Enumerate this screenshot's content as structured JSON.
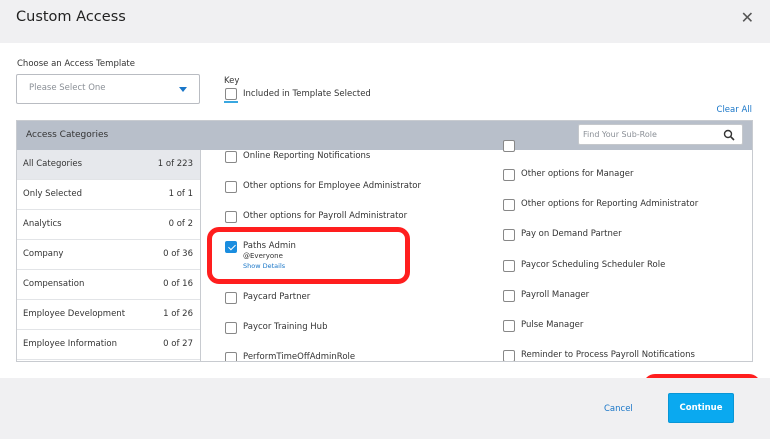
{
  "modal": {
    "title": "Custom Access"
  },
  "template": {
    "label": "Choose an Access Template",
    "placeholder": "Please Select One"
  },
  "key": {
    "label": "Key",
    "text": "Included in Template Selected"
  },
  "clear_all": "Clear All",
  "categories_panel": {
    "header": "Access Categories",
    "search_placeholder": "Find Your Sub-Role",
    "items": [
      {
        "name": "All Categories",
        "count": "1 of 223",
        "selected": true
      },
      {
        "name": "Only Selected",
        "count": "1 of 1",
        "selected": false
      },
      {
        "name": "Analytics",
        "count": "0 of 2",
        "selected": false
      },
      {
        "name": "Company",
        "count": "0 of 36",
        "selected": false
      },
      {
        "name": "Compensation",
        "count": "0 of 16",
        "selected": false
      },
      {
        "name": "Employee Development",
        "count": "1 of 26",
        "selected": false
      },
      {
        "name": "Employee Information",
        "count": "0 of 27",
        "selected": false
      }
    ]
  },
  "roles_left": [
    {
      "label": "Online Reporting Notifications",
      "checked": false
    },
    {
      "label": "Other options for Employee Administrator",
      "checked": false
    },
    {
      "label": "Other options for Payroll Administrator",
      "checked": false
    },
    {
      "label": "Paths Admin",
      "checked": true,
      "sub": "@Everyone",
      "details": "Show Details"
    },
    {
      "label": "Paycard Partner",
      "checked": false
    },
    {
      "label": "Paycor Training Hub",
      "checked": false
    },
    {
      "label": "PerformTimeOffAdminRole",
      "checked": false
    }
  ],
  "roles_right": [
    {
      "label": "Other options for Manager",
      "checked": false
    },
    {
      "label": "Other options for Reporting Administrator",
      "checked": false
    },
    {
      "label": "Pay on Demand Partner",
      "checked": false
    },
    {
      "label": "Paycor Scheduling Scheduler Role",
      "checked": false
    },
    {
      "label": "Payroll Manager",
      "checked": false
    },
    {
      "label": "Pulse Manager",
      "checked": false
    },
    {
      "label": "Reminder to Process Payroll Notifications",
      "checked": false
    }
  ],
  "footer": {
    "cancel_label": "Cancel",
    "continue_label": "Continue"
  },
  "colors": {
    "accent": "#0aa9f0",
    "link": "#1976c8",
    "highlight": "#ff1e1e",
    "header_bg": "#f0f0f2",
    "panel_header_bg": "#b8bfca"
  },
  "icons": {
    "close": "close-icon",
    "dropdown": "chevron-down-icon",
    "search": "search-icon"
  }
}
